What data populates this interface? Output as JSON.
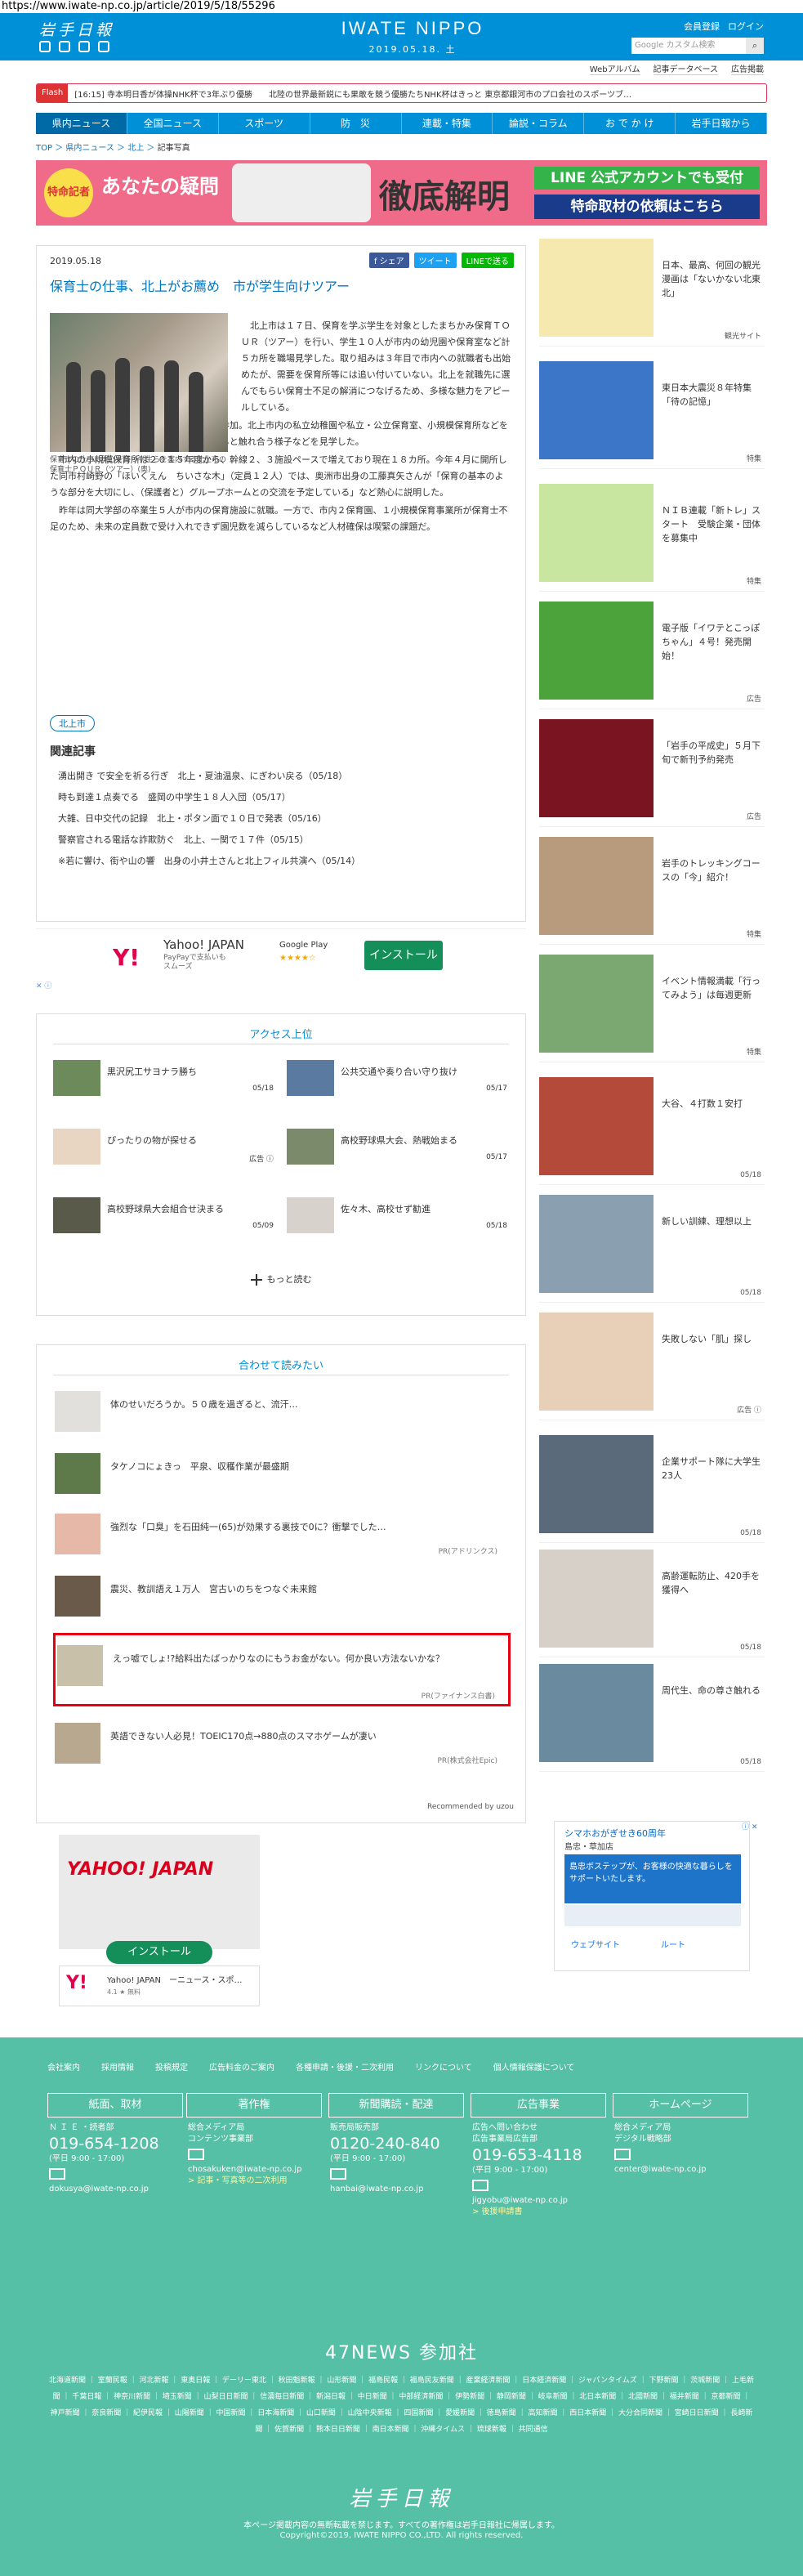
{
  "url": "https://www.iwate-np.co.jp/article/2019/5/18/55296",
  "header": {
    "logo": "岩手日報",
    "brand": "IWATE NIPPO",
    "date": "2019.05.18. 土",
    "links": [
      "会員登録",
      "ログイン"
    ],
    "search_placeholder": "Google カスタム検索",
    "subnav": [
      "Webアルバム",
      "記事データベース",
      "広告掲載"
    ]
  },
  "flash": {
    "tag": "Flash",
    "text": "[16:15] 寺本明日香が体操NHK杯で3年ぶり優勝　　北陸の世界最新鋭にも果敢を競う優勝たちNHK杯はきっと 東京都銀河市のプロ会社のスポーツブ…"
  },
  "gnav": [
    "県内ニュース",
    "全国ニュース",
    "スポーツ",
    "防　災",
    "連載・特集",
    "論説・コラム",
    "お で か け",
    "岩手日報から"
  ],
  "breadcrumb": [
    "TOP",
    "県内ニュース",
    "北上",
    "記事写真"
  ],
  "banner": {
    "badge": "特命記者",
    "q": "あなたの疑問",
    "big": "徹底解明",
    "line1": "LINE 公式アカウントでも受付",
    "line2": "特命取材の依頼はこちら"
  },
  "article": {
    "date": "2019.05.18",
    "share": [
      "f シェア",
      "ツイート",
      "LINEで送る"
    ],
    "title": "保育士の仕事、北上がお薦め　市が学生向けツアー",
    "caption": "保育士の仕事に関心を持つ学生らを案内する北上市の保育士ＰＯＵＲ（ツアー）(奥)",
    "paragraphs": [
      "北上市は１７日、保育を学ぶ学生を対象としたまちかみ保育ＴＯＵＲ（ツアー）を行い、学生１０人が市内の幼児園や保育室など計５カ所を職場見学した。取り組みは３年目で市内への就職者も出始めたが、需要を保育所等には追い付いていない。北上を就職先に選んでもらい保育士不足の解消につなげるため、多様な魅力をアピールしている。",
      "盛岡市短期大学部幼児教育科の２年生が参加。北上市内の私立幼稚園や私立・公立保育室、小規模保育所などを見学、職員から仕事内容を聞きながら子どもと触れ合う様子などを見学した。",
      "市内の小規模保育所は２０１５年度から、幹線２、３施設ペースで増えており現在１８カ所。今年４月に開所した同市村崎野の「ほいくえん　ちいさな木」（定員１２人）では、奥洲市出身の工藤真矢さんが「保育の基本のような部分を大切にし、（保護者と）グループホームとの交流を予定している」など熱心に説明した。",
      "昨年は同大学部の卒業生５人が市内の保育施設に就職。一方で、市内２保育園、１小規模保育事業所が保育士不足のため、未来の定員数で受け入れできず園児数を減らしているなど人材確保は喫緊の課題だ。"
    ],
    "keyword": "北上市",
    "related_heading": "関連記事",
    "related": [
      "湧出開き で安全を祈る行ぎ　北上・夏油温泉、にぎわい戻る（05/18）",
      "時も到達１点奏でる　盛岡の中学生１８人入団（05/17）",
      "大雑、日中交代の記録　北上・ポタン面で１０日で発表（05/16）",
      "警察官される電話な詐欺防ぐ　北上、一関で１７件（05/15）",
      "※若に響け、街や山の響　出身の小井土さんと北上フィル共演へ（05/14）"
    ]
  },
  "ad_yahoo": {
    "logo": "Y!",
    "title": "Yahoo! JAPAN",
    "sub": "PayPayで支払いもスムーズ",
    "store": "Google Play",
    "stars": "★★★★☆",
    "button": "インストール"
  },
  "ranking": {
    "heading": "アクセス上位",
    "items": [
      {
        "title": "黒沢尻工サヨナラ勝ち",
        "date": "05/18"
      },
      {
        "title": "公共交通や奏り合い守り抜け",
        "date": "05/17"
      },
      {
        "title": "ぴったりの物が探せる",
        "date": "広告 ⓘ"
      },
      {
        "title": "高校野球県大会、熱戦始まる",
        "date": "05/17"
      },
      {
        "title": "高校野球県大会組合せ決まる",
        "date": "05/09"
      },
      {
        "title": "佐々木、高校せず勧進",
        "date": "05/18"
      }
    ],
    "more": "もっと読む"
  },
  "recommend": {
    "heading": "合わせて読みたい",
    "items": [
      {
        "title": "体のせいだろうか。５０歳を過ぎると、流汗…",
        "pr": ""
      },
      {
        "title": "タケノコにょきっ　平泉、収穫作業が最盛期",
        "pr": ""
      },
      {
        "title": "強烈な「口臭」を石田純一(65)が効果する裏技で0に？衝撃でした…",
        "pr": "PR(アドリンクス)"
      },
      {
        "title": "震災、教訓語え１万人　宮古いのちをつなぐ未来館",
        "pr": ""
      },
      {
        "title": "えっ嘘でしょ!?給料出たばっかりなのにもうお金がない。何か良い方法ないかな？",
        "pr": "PR(ファイナンス白書)"
      },
      {
        "title": "英語できない人必見！TOEIC170点→880点のスマホゲームが凄い",
        "pr": "PR(株式会社Epic)"
      }
    ],
    "powered": "Recommended by uzou"
  },
  "ad_yahoo2": {
    "logo": "YAHOO! JAPAN",
    "button": "インストール",
    "name": "Yahoo! JAPAN　ーニュース・スポ…",
    "rating": "4.1 ★ 無料"
  },
  "sidebar": [
    {
      "title": "日本、最高、何回の観光漫画は「ないかない北東北」",
      "label": "観光サイト",
      "color": "#f5e9b0"
    },
    {
      "title": "東日本大震災８年特集「待の記憶」",
      "label": "特集",
      "color": "#3b76c9"
    },
    {
      "title": "ＮＩＢ連載「新トレ」スタート　受験企業・団体を募集中",
      "label": "特集",
      "color": "#c8e6a0"
    },
    {
      "title": "電子版「イワテとこっぽちゃん」４号！発売開始！",
      "label": "広告",
      "color": "#4da33b"
    },
    {
      "title": "「岩手の平成史」５月下旬で新刊予約発売",
      "label": "広告",
      "color": "#7a1420"
    },
    {
      "title": "岩手のトレッキングコースの「今」紹介！",
      "label": "特集",
      "color": "#b89a7c"
    },
    {
      "title": "イベント情報満載「行ってみよう」は毎週更新",
      "label": "特集",
      "color": "#7aa870"
    },
    {
      "title": "大谷、４打数１安打",
      "label": "05/18",
      "color": "#b34a3a"
    },
    {
      "title": "新しい訓練、理想以上",
      "label": "05/18",
      "color": "#8aa0b0"
    },
    {
      "title": "失敗しない「肌」探し",
      "label": "広告 ⓘ",
      "color": "#e7cfb8"
    },
    {
      "title": "企業サポート隊に大学生23人",
      "label": "05/18",
      "color": "#5a6a7a"
    },
    {
      "title": "高齢運転防止、420手を獲得へ",
      "label": "05/18",
      "color": "#d6d0c8"
    },
    {
      "title": "周代生、命の尊さ触れる",
      "label": "05/18",
      "color": "#6a8aa0"
    }
  ],
  "ad_map": {
    "head": "シマホおがぎせき60周年",
    "sub": "島忠・草加店",
    "body": "島忠ボステップが、お客様の快適な暮らしをサポートいたします。",
    "btn1": "ウェブサイト",
    "btn2": "ルート"
  },
  "footer": {
    "links": [
      "会社案内",
      "採用情報",
      "投稿規定",
      "広告料金のご案内",
      "各種申請・後援・二次利用",
      "リンクについて",
      "個人情報保護について"
    ],
    "cols": [
      {
        "btn": "紙面、取材",
        "lines": [
          "Ｎ Ｉ Ｅ ・読者部"
        ],
        "tel": "019-654-1208",
        "hours": "(平日 9:00 - 17:00)",
        "mail": "dokusya@iwate-np.co.jp",
        "extra": ""
      },
      {
        "btn": "著作権",
        "lines": [
          "総合メディア局",
          "コンテンツ事業部"
        ],
        "tel": "",
        "hours": "",
        "mail": "chosakuken@iwate-np.co.jp",
        "extra": "> 記事・写真等の二次利用"
      },
      {
        "btn": "新聞購読・配達",
        "lines": [
          "販売局販売部"
        ],
        "tel": "0120-240-840",
        "hours": "(平日 9:00 - 17:00)",
        "mail": "hanbai@iwate-np.co.jp",
        "extra": ""
      },
      {
        "btn": "広告事業",
        "lines": [
          "広告へ問い合わせ",
          "広告事業局広告部"
        ],
        "tel": "019-653-4118",
        "hours": "(平日 9:00 - 17:00)",
        "mail": "jigyobu@iwate-np.co.jp",
        "extra": "> 後援申請書"
      },
      {
        "btn": "ホームページ",
        "lines": [
          "総合メディア局",
          "デジタル戦略部"
        ],
        "tel": "",
        "hours": "",
        "mail": "center@iwate-np.co.jp",
        "extra": ""
      }
    ],
    "news47": "47NEWS 参加社",
    "papers": "北海道新聞 ｜ 室蘭民報 ｜ 河北新報 ｜ 東奥日報 ｜ デーリー東北 ｜ 秋田魁新報 ｜ 山形新聞 ｜ 福島民報 ｜ 福島民友新聞 ｜ 産業経済新聞 ｜ 日本経済新聞 ｜ ジャパンタイムズ ｜ 下野新聞 ｜ 茨城新聞 ｜ 上毛新聞 ｜ 千葉日報 ｜ 神奈川新聞 ｜ 埼玉新聞 ｜ 山梨日日新聞 ｜ 信濃毎日新聞 ｜ 新潟日報 ｜ 中日新聞 ｜ 中部経済新聞 ｜ 伊勢新聞 ｜ 静岡新聞 ｜ 岐阜新聞 ｜ 北日本新聞 ｜ 北國新聞 ｜ 福井新聞 ｜ 京都新聞 ｜ 神戸新聞 ｜ 奈良新聞 ｜ 紀伊民報 ｜ 山陽新聞 ｜ 中国新聞 ｜ 日本海新聞 ｜ 山口新聞 ｜ 山陰中央新報 ｜ 四国新聞 ｜ 愛媛新聞 ｜ 徳島新聞 ｜ 高知新聞 ｜ 西日本新聞 ｜ 大分合同新聞 ｜ 宮崎日日新聞 ｜ 長崎新聞 ｜ 佐賀新聞 ｜ 熊本日日新聞 ｜ 南日本新聞 ｜ 沖縄タイムス ｜ 琉球新報 ｜ 共同通信",
    "logo": "岩手日報",
    "notice": "本ページ掲載内容の無断転載を禁じます。すべての著作権は岩手日報社に帰属します。",
    "copyright": "Copyright©2019, IWATE NIPPO CO.,LTD. All rights reserved."
  }
}
